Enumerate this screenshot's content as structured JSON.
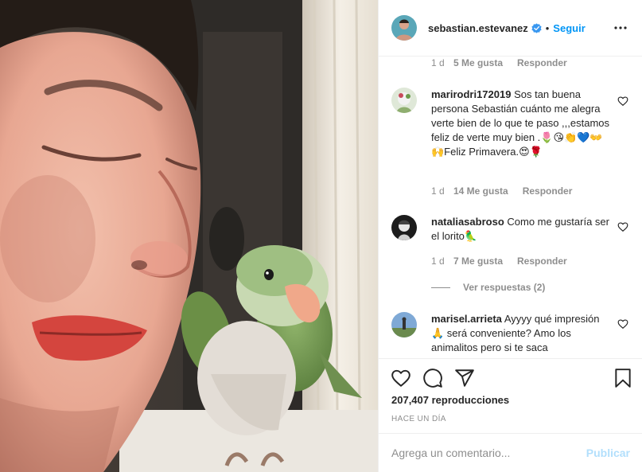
{
  "header": {
    "username": "sebastian.estevanez",
    "separator": "•",
    "follow_label": "Seguir"
  },
  "comments": {
    "top_meta": {
      "time": "1 d",
      "likes": "5 Me gusta",
      "reply": "Responder"
    },
    "items": [
      {
        "username": "marirodri172019",
        "text": "Sos tan buena persona Sebastián cuánto me alegra verte bien de lo que te paso ,,,estamos feliz de verte muy bien .🌷😘👏💙👐🙌Feliz Primavera.😍🌹",
        "time": "1 d",
        "likes": "14 Me gusta",
        "reply": "Responder"
      },
      {
        "username": "nataliasabroso",
        "text": "Como me gustaría ser el lorito🦜",
        "time": "1 d",
        "likes": "7 Me gusta",
        "reply": "Responder",
        "view_replies": "Ver respuestas (2)"
      },
      {
        "username": "marisel.arrieta",
        "text": "Ayyyy qué impresión🙏 será conveniente? Amo los animalitos pero si te saca"
      }
    ]
  },
  "stats": {
    "views": "207,407 reproducciones",
    "when": "HACE UN DÍA"
  },
  "composer": {
    "placeholder": "Agrega un comentario...",
    "publish_label": "Publicar"
  },
  "colors": {
    "accent": "#0095f6",
    "publish_disabled": "#b2dffc",
    "muted": "#8e8e8e",
    "border": "#efefef",
    "text": "#262626"
  },
  "icons": [
    "verified-badge-icon",
    "more-options-icon",
    "heart-icon",
    "comment-icon",
    "share-icon",
    "bookmark-icon"
  ]
}
